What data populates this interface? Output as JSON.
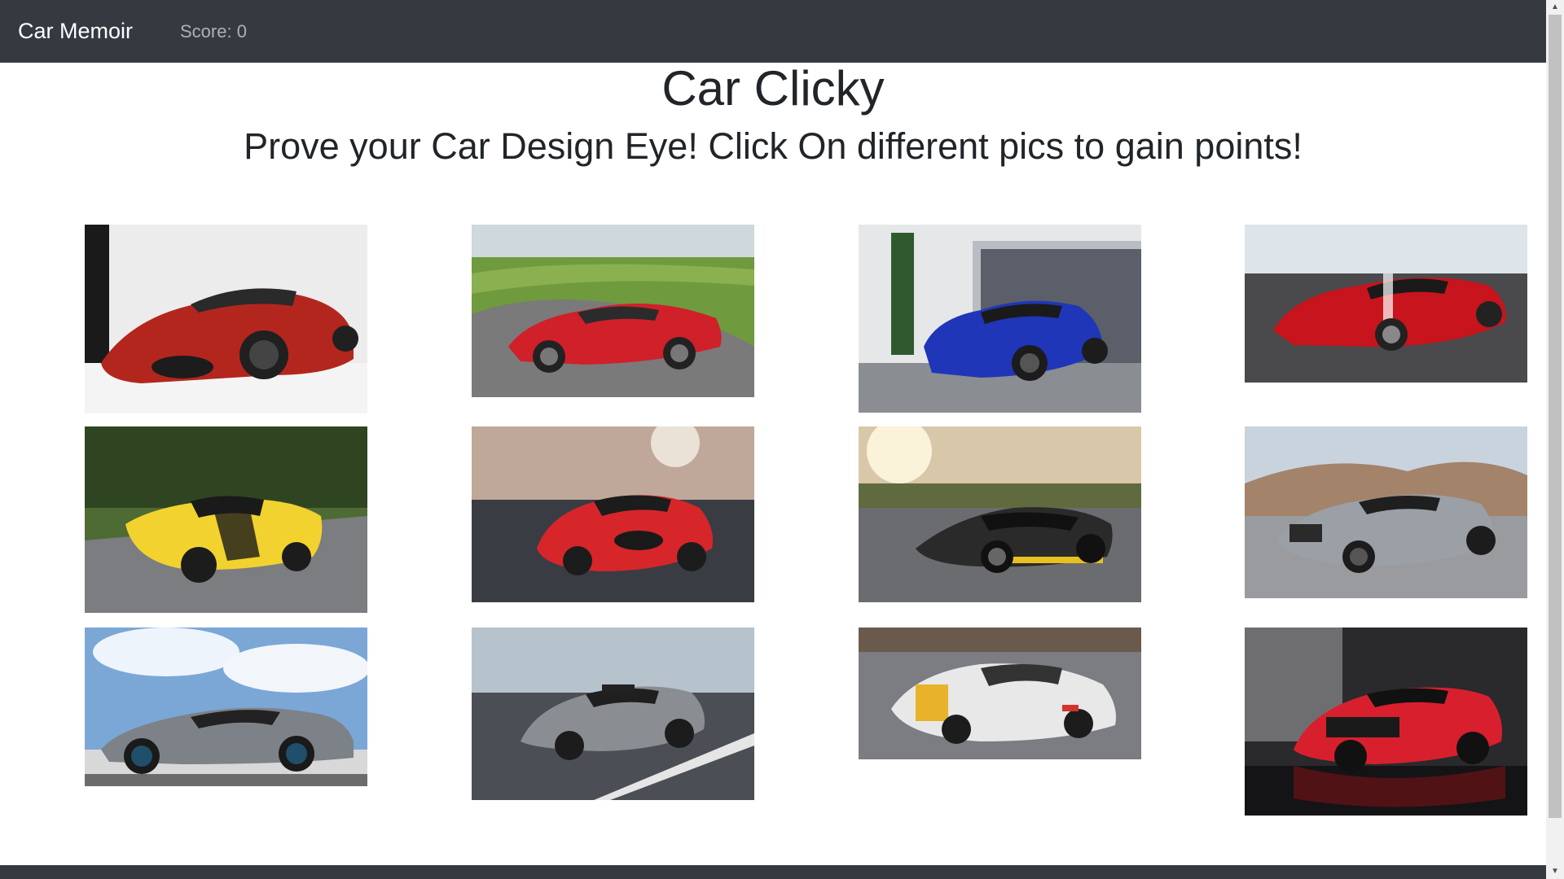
{
  "navbar": {
    "brand": "Car Memoir",
    "score_text": "Score: 0"
  },
  "header": {
    "title": "Car Clicky",
    "subtitle": "Prove your Car Design Eye! Click On different pics to gain points!"
  },
  "cards": [
    {
      "name": "car-card-red-coupe-studio",
      "color": "#b3261e"
    },
    {
      "name": "car-card-red-supercar-track",
      "color": "#d0202a"
    },
    {
      "name": "car-card-blue-sedan",
      "color": "#1f36b8"
    },
    {
      "name": "car-card-red-supercar-road",
      "color": "#c8141c"
    },
    {
      "name": "car-card-yellow-supercar",
      "color": "#f2d22e"
    },
    {
      "name": "car-card-red-sports-coupe",
      "color": "#d6262a"
    },
    {
      "name": "car-card-black-hypercar",
      "color": "#2a2a2a"
    },
    {
      "name": "car-card-silver-coupe",
      "color": "#9aa0a6"
    },
    {
      "name": "car-card-silver-hypercar",
      "color": "#7d8288"
    },
    {
      "name": "car-card-grey-race-coupe",
      "color": "#8a8d91"
    },
    {
      "name": "car-card-white-classic-coupe",
      "color": "#e8e8e8"
    },
    {
      "name": "car-card-red-supercar-garage",
      "color": "#d81f2e"
    }
  ],
  "colors": {
    "navbar_bg": "#343a40",
    "brand_text": "#ffffff",
    "score_text": "#9a9da0"
  }
}
